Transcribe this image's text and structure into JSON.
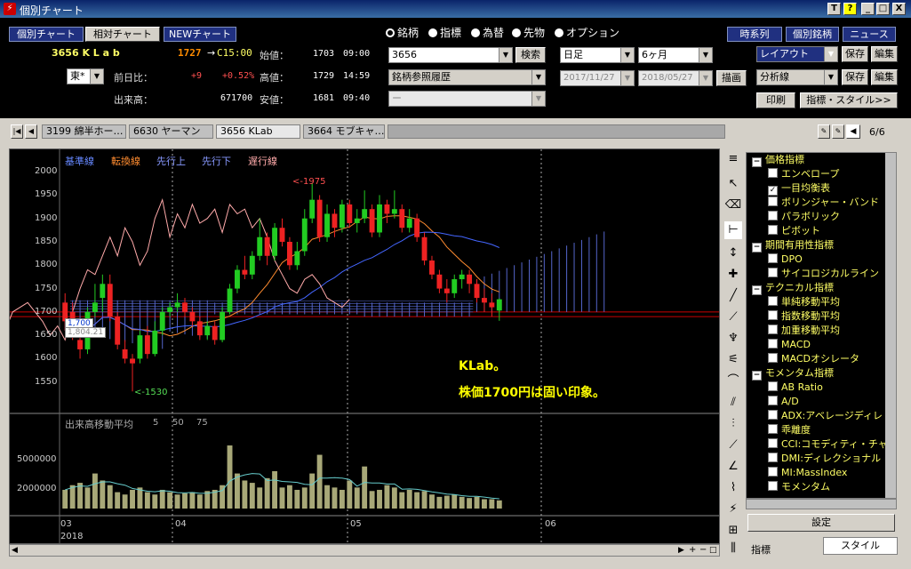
{
  "window": {
    "title": "個別チャート",
    "controls": [
      "T",
      "?",
      "_",
      "□",
      "X"
    ]
  },
  "nav": {
    "individual": "個別チャート",
    "relative": "相対チャート",
    "new": "NEWチャート",
    "timeseries": "時系列",
    "individual_stock": "個別銘柄",
    "news": "ニュース"
  },
  "quote": {
    "code_name": "3656 K L a b",
    "price": "1727",
    "arrow": "→",
    "close_mark": "C15:00",
    "market": "東*",
    "change_label": "前日比：",
    "change": "+9",
    "change_pct": "+0.52%",
    "volume_label": "出来高：",
    "volume": "671700",
    "open_label": "始値：",
    "open": "1703",
    "open_time": "09:00",
    "high_label": "高値：",
    "high": "1729",
    "high_time": "14:59",
    "low_label": "安値：",
    "low": "1681",
    "low_time": "09:40"
  },
  "types": {
    "stock": "銘柄",
    "index": "指標",
    "fx": "為替",
    "futures": "先物",
    "option": "オプション"
  },
  "search": {
    "code": "3656",
    "search_btn": "検索",
    "history": "銘柄参照履歴",
    "blank": "ー"
  },
  "period": {
    "interval": "日足",
    "range": "6ヶ月",
    "from": "2017/11/27",
    "to": "2018/05/27",
    "draw": "描画"
  },
  "layout": {
    "layout": "レイアウト",
    "save": "保存",
    "edit": "編集",
    "analysis": "分析線",
    "print": "印刷",
    "style": "指標・スタイル>>"
  },
  "tabs": [
    "3199 綿半ホー…",
    "6630 ヤーマン",
    "3656 KLab",
    "3664 モブキャ…"
  ],
  "page_counter": "6/6",
  "chart": {
    "legend": {
      "kijun": "基準線",
      "tenkan": "転換線",
      "senkou1": "先行上",
      "senkou2": "先行下",
      "chikou": "遅行線"
    },
    "yticks": [
      "2000",
      "1950",
      "1900",
      "1850",
      "1800",
      "1750",
      "1700",
      "1650",
      "1600",
      "1550"
    ],
    "high_label": "<-1975",
    "low_label": "<-1530",
    "price_tag": "1,700",
    "price_tag2": "1,804.21",
    "volume_legend": "出来高移動平均",
    "ma_periods": [
      "5",
      "50",
      "75"
    ],
    "vol_yticks": [
      "5000000",
      "2000000"
    ],
    "xticks": [
      "03",
      "04",
      "05",
      "06"
    ],
    "year": "2018",
    "annotation1": "KLab。",
    "annotation2": "株価1700円は固い印象。"
  },
  "chart_data": {
    "type": "candlestick",
    "ylim": [
      1500,
      2025
    ],
    "candles": [
      [
        1720,
        1680,
        1740,
        1660
      ],
      [
        1700,
        1650,
        1720,
        1640
      ],
      [
        1640,
        1620,
        1660,
        1600
      ],
      [
        1620,
        1700,
        1710,
        1610
      ],
      [
        1700,
        1720,
        1760,
        1690
      ],
      [
        1730,
        1760,
        1780,
        1700
      ],
      [
        1760,
        1690,
        1780,
        1680
      ],
      [
        1690,
        1630,
        1700,
        1620
      ],
      [
        1620,
        1600,
        1640,
        1590
      ],
      [
        1600,
        1590,
        1610,
        1530
      ],
      [
        1600,
        1650,
        1660,
        1590
      ],
      [
        1650,
        1610,
        1670,
        1600
      ],
      [
        1610,
        1660,
        1680,
        1605
      ],
      [
        1660,
        1700,
        1710,
        1650
      ],
      [
        1700,
        1710,
        1720,
        1690
      ],
      [
        1710,
        1720,
        1740,
        1700
      ],
      [
        1720,
        1700,
        1730,
        1690
      ],
      [
        1700,
        1680,
        1710,
        1670
      ],
      [
        1680,
        1650,
        1690,
        1640
      ],
      [
        1650,
        1670,
        1680,
        1640
      ],
      [
        1670,
        1640,
        1680,
        1630
      ],
      [
        1640,
        1700,
        1710,
        1635
      ],
      [
        1700,
        1750,
        1760,
        1695
      ],
      [
        1750,
        1790,
        1800,
        1740
      ],
      [
        1790,
        1780,
        1820,
        1770
      ],
      [
        1780,
        1820,
        1830,
        1770
      ],
      [
        1820,
        1860,
        1900,
        1810
      ],
      [
        1860,
        1820,
        1870,
        1800
      ],
      [
        1820,
        1880,
        1890,
        1810
      ],
      [
        1880,
        1850,
        1900,
        1840
      ],
      [
        1850,
        1800,
        1860,
        1790
      ],
      [
        1800,
        1830,
        1850,
        1790
      ],
      [
        1830,
        1900,
        1920,
        1820
      ],
      [
        1900,
        1940,
        1975,
        1890
      ],
      [
        1940,
        1860,
        1950,
        1850
      ],
      [
        1860,
        1910,
        1930,
        1850
      ],
      [
        1910,
        1880,
        1920,
        1860
      ],
      [
        1880,
        1930,
        1940,
        1870
      ],
      [
        1930,
        1890,
        1940,
        1880
      ],
      [
        1890,
        1900,
        1920,
        1870
      ],
      [
        1900,
        1920,
        1960,
        1890
      ],
      [
        1920,
        1870,
        1930,
        1860
      ],
      [
        1870,
        1930,
        1950,
        1860
      ],
      [
        1930,
        1910,
        1940,
        1890
      ],
      [
        1910,
        1920,
        1960,
        1900
      ],
      [
        1920,
        1880,
        1930,
        1870
      ],
      [
        1880,
        1900,
        1920,
        1870
      ],
      [
        1900,
        1860,
        1910,
        1850
      ],
      [
        1860,
        1810,
        1870,
        1800
      ],
      [
        1810,
        1780,
        1820,
        1770
      ],
      [
        1780,
        1750,
        1790,
        1740
      ],
      [
        1750,
        1740,
        1770,
        1720
      ],
      [
        1740,
        1770,
        1780,
        1730
      ],
      [
        1770,
        1780,
        1790,
        1750
      ],
      [
        1780,
        1760,
        1790,
        1740
      ],
      [
        1760,
        1730,
        1770,
        1720
      ],
      [
        1730,
        1720,
        1750,
        1700
      ],
      [
        1720,
        1710,
        1740,
        1690
      ],
      [
        1703,
        1727,
        1729,
        1681
      ]
    ],
    "volume": [
      1.6,
      2.0,
      2.2,
      1.8,
      3.0,
      2.4,
      2.0,
      1.4,
      1.2,
      1.6,
      1.8,
      1.4,
      1.2,
      1.6,
      1.4,
      1.2,
      1.3,
      1.4,
      1.2,
      1.5,
      1.6,
      2.0,
      5.4,
      3.0,
      2.4,
      2.2,
      1.8,
      2.6,
      3.2,
      1.8,
      2.0,
      1.6,
      1.8,
      3.0,
      4.6,
      2.0,
      1.8,
      1.6,
      2.4,
      1.8,
      3.6,
      1.5,
      1.6,
      2.0,
      1.8,
      1.4,
      1.6,
      1.4,
      1.5,
      1.2,
      1.0,
      1.1,
      1.2,
      1.0,
      0.9,
      1.0,
      0.8,
      0.8,
      0.7
    ],
    "vol_ylim": [
      0,
      7.0
    ]
  },
  "indicators": [
    {
      "t": "g",
      "label": "価格指標"
    },
    {
      "t": "i",
      "label": "エンベロープ",
      "checked": false
    },
    {
      "t": "i",
      "label": "一目均衡表",
      "checked": true
    },
    {
      "t": "i",
      "label": "ボリンジャー・バンド",
      "checked": false
    },
    {
      "t": "i",
      "label": "パラボリック",
      "checked": false
    },
    {
      "t": "i",
      "label": "ピボット",
      "checked": false
    },
    {
      "t": "g",
      "label": "期間有用性指標"
    },
    {
      "t": "i",
      "label": "DPO",
      "checked": false
    },
    {
      "t": "i",
      "label": "サイコロジカルライン",
      "checked": false
    },
    {
      "t": "g",
      "label": "テクニカル指標"
    },
    {
      "t": "i",
      "label": "単純移動平均",
      "checked": false
    },
    {
      "t": "i",
      "label": "指数移動平均",
      "checked": false
    },
    {
      "t": "i",
      "label": "加重移動平均",
      "checked": false
    },
    {
      "t": "i",
      "label": "MACD",
      "checked": false
    },
    {
      "t": "i",
      "label": "MACDオシレータ",
      "checked": false
    },
    {
      "t": "g",
      "label": "モメンタム指標"
    },
    {
      "t": "i",
      "label": "AB Ratio",
      "checked": false
    },
    {
      "t": "i",
      "label": "A/D",
      "checked": false
    },
    {
      "t": "i",
      "label": "ADX:アベレージディレ",
      "checked": false
    },
    {
      "t": "i",
      "label": "乖離度",
      "checked": false
    },
    {
      "t": "i",
      "label": "CCI:コモディティ・チャ",
      "checked": false
    },
    {
      "t": "i",
      "label": "DMI:ディレクショナル",
      "checked": false
    },
    {
      "t": "i",
      "label": "MI:MassIndex",
      "checked": false
    },
    {
      "t": "i",
      "label": "モメンタム",
      "checked": false
    }
  ],
  "panel": {
    "settings": "設定",
    "tab_indicator": "指標",
    "tab_style": "スタイル"
  }
}
